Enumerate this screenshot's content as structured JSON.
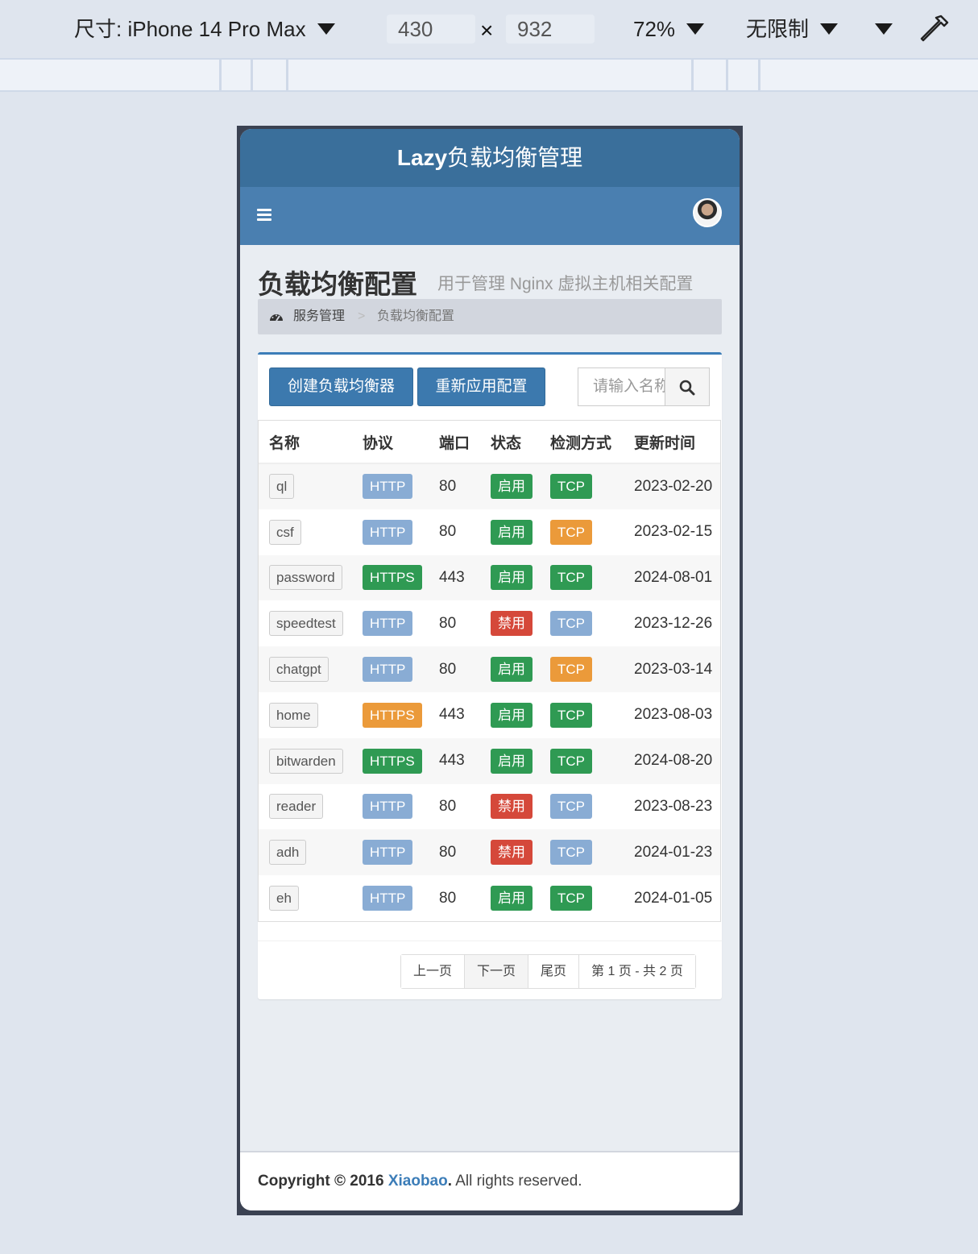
{
  "devtools": {
    "device_label": "尺寸: iPhone 14 Pro Max",
    "width": "430",
    "times": "×",
    "height": "932",
    "zoom": "72%",
    "throttle": "无限制"
  },
  "app": {
    "logo_bold": "Lazy",
    "logo_rest": "负载均衡管理"
  },
  "header": {
    "title": "负载均衡配置",
    "subtitle": "用于管理 Nginx 虚拟主机相关配置"
  },
  "breadcrumb": {
    "home": "服务管理",
    "separator": ">",
    "current": "负载均衡配置"
  },
  "toolbar": {
    "create_label": "创建负载均衡器",
    "reapply_label": "重新应用配置",
    "search_placeholder": "请输入名称"
  },
  "table": {
    "columns": [
      "名称",
      "协议",
      "端口",
      "状态",
      "检测方式",
      "更新时间"
    ],
    "rows": [
      {
        "name": "ql",
        "protocol": "HTTP",
        "protocol_color": "#89acd4",
        "port": "80",
        "status": "启用",
        "status_color": "#2f9a53",
        "check": "TCP",
        "check_color": "#2f9a53",
        "updated": "2023-02-20"
      },
      {
        "name": "csf",
        "protocol": "HTTP",
        "protocol_color": "#89acd4",
        "port": "80",
        "status": "启用",
        "status_color": "#2f9a53",
        "check": "TCP",
        "check_color": "#eb9a3a",
        "updated": "2023-02-15"
      },
      {
        "name": "password",
        "protocol": "HTTPS",
        "protocol_color": "#2f9a53",
        "port": "443",
        "status": "启用",
        "status_color": "#2f9a53",
        "check": "TCP",
        "check_color": "#2f9a53",
        "updated": "2024-08-01"
      },
      {
        "name": "speedtest",
        "protocol": "HTTP",
        "protocol_color": "#89acd4",
        "port": "80",
        "status": "禁用",
        "status_color": "#d5483a",
        "check": "TCP",
        "check_color": "#89acd4",
        "updated": "2023-12-26"
      },
      {
        "name": "chatgpt",
        "protocol": "HTTP",
        "protocol_color": "#89acd4",
        "port": "80",
        "status": "启用",
        "status_color": "#2f9a53",
        "check": "TCP",
        "check_color": "#eb9a3a",
        "updated": "2023-03-14"
      },
      {
        "name": "home",
        "protocol": "HTTPS",
        "protocol_color": "#eb9a3a",
        "port": "443",
        "status": "启用",
        "status_color": "#2f9a53",
        "check": "TCP",
        "check_color": "#2f9a53",
        "updated": "2023-08-03"
      },
      {
        "name": "bitwarden",
        "protocol": "HTTPS",
        "protocol_color": "#2f9a53",
        "port": "443",
        "status": "启用",
        "status_color": "#2f9a53",
        "check": "TCP",
        "check_color": "#2f9a53",
        "updated": "2024-08-20"
      },
      {
        "name": "reader",
        "protocol": "HTTP",
        "protocol_color": "#89acd4",
        "port": "80",
        "status": "禁用",
        "status_color": "#d5483a",
        "check": "TCP",
        "check_color": "#89acd4",
        "updated": "2023-08-23"
      },
      {
        "name": "adh",
        "protocol": "HTTP",
        "protocol_color": "#89acd4",
        "port": "80",
        "status": "禁用",
        "status_color": "#d5483a",
        "check": "TCP",
        "check_color": "#89acd4",
        "updated": "2024-01-23"
      },
      {
        "name": "eh",
        "protocol": "HTTP",
        "protocol_color": "#89acd4",
        "port": "80",
        "status": "启用",
        "status_color": "#2f9a53",
        "check": "TCP",
        "check_color": "#2f9a53",
        "updated": "2024-01-05"
      }
    ]
  },
  "pagination": {
    "prev": "上一页",
    "next": "下一页",
    "last": "尾页",
    "info": "第 1 页 - 共 2 页"
  },
  "footer": {
    "copyright": "Copyright © 2016",
    "brand": "Xiaobao",
    "dot": ".",
    "rights": "All rights reserved."
  },
  "icons": {
    "menu": "hamburger-icon",
    "avatar": "user-avatar",
    "breadcrumb": "dashboard-icon",
    "search": "search-icon",
    "eyedropper": "eyedropper-icon",
    "dropdown": "caret-down-icon"
  }
}
